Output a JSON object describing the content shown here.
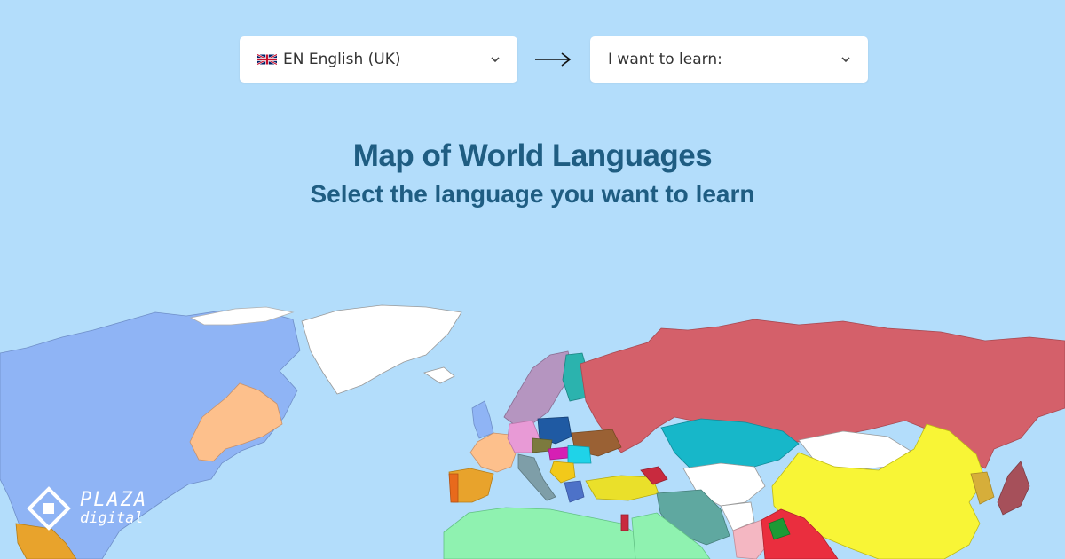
{
  "language_selector": {
    "source": {
      "code": "EN",
      "name": "English (UK)",
      "display": "EN English (UK)"
    },
    "target": {
      "placeholder": "I want to learn:"
    }
  },
  "heading": {
    "title": "Map of World Languages",
    "subtitle": "Select the language you want to learn"
  },
  "logo": {
    "line1": "PLAZA",
    "line2": "digital"
  },
  "colors": {
    "background": "#b3ddfb",
    "heading": "#1f5d82",
    "russian": "#d4606a",
    "chinese": "#f8f536",
    "english": "#8fb4f5",
    "french": "#fdc08c",
    "arabic": "#8ff2b0"
  },
  "icons": {
    "flag": "uk-flag-icon",
    "chevron": "chevron-down-icon",
    "arrow": "arrow-right-icon"
  }
}
